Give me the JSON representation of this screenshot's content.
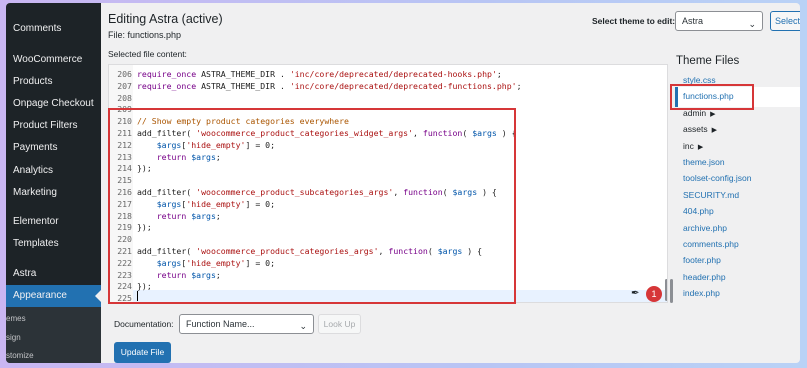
{
  "sidebar": {
    "items": [
      {
        "label": "Comments"
      },
      {
        "label": "WooCommerce"
      },
      {
        "label": "Products"
      },
      {
        "label": "Onpage Checkout"
      },
      {
        "label": "Product Filters"
      },
      {
        "label": "Payments"
      },
      {
        "label": "Analytics"
      },
      {
        "label": "Marketing"
      },
      {
        "label": "Elementor"
      },
      {
        "label": "Templates"
      },
      {
        "label": "Astra"
      },
      {
        "label": "Appearance"
      }
    ],
    "submenu": [
      {
        "label": "emes"
      },
      {
        "label": "sign"
      },
      {
        "label": "stomize"
      }
    ]
  },
  "header": {
    "title": "Editing Astra (active)",
    "file": "File: functions.php",
    "selected_label": "Selected file content:",
    "theme_label": "Select theme to edit:",
    "theme_value": "Astra",
    "theme_button": "Select"
  },
  "editor": {
    "lines": [
      {
        "n": "206",
        "code": "require_once ASTRA_THEME_DIR . 'inc/core/deprecated/deprecated-hooks.php';"
      },
      {
        "n": "207",
        "code": "require_once ASTRA_THEME_DIR . 'inc/core/deprecated/deprecated-functions.php';"
      },
      {
        "n": "208",
        "code": ""
      },
      {
        "n": "209",
        "code": ""
      },
      {
        "n": "210",
        "code": "// Show empty product categories everywhere"
      },
      {
        "n": "211",
        "code": "add_filter( 'woocommerce_product_categories_widget_args', function( $args ) {"
      },
      {
        "n": "212",
        "code": "    $args['hide_empty'] = 0;"
      },
      {
        "n": "213",
        "code": "    return $args;"
      },
      {
        "n": "214",
        "code": "});"
      },
      {
        "n": "215",
        "code": ""
      },
      {
        "n": "216",
        "code": "add_filter( 'woocommerce_product_subcategories_args', function( $args ) {"
      },
      {
        "n": "217",
        "code": "    $args['hide_empty'] = 0;"
      },
      {
        "n": "218",
        "code": "    return $args;"
      },
      {
        "n": "219",
        "code": "});"
      },
      {
        "n": "220",
        "code": ""
      },
      {
        "n": "221",
        "code": "add_filter( 'woocommerce_product_categories_args', function( $args ) {"
      },
      {
        "n": "222",
        "code": "    $args['hide_empty'] = 0;"
      },
      {
        "n": "223",
        "code": "    return $args;"
      },
      {
        "n": "224",
        "code": "});"
      },
      {
        "n": "225",
        "code": ""
      }
    ],
    "notification_count": "1"
  },
  "theme_files": {
    "title": "Theme Files",
    "items": [
      {
        "label": "style.css",
        "type": "file"
      },
      {
        "label": "functions.php",
        "type": "current"
      },
      {
        "label": "admin",
        "type": "dir"
      },
      {
        "label": "assets",
        "type": "dir"
      },
      {
        "label": "inc",
        "type": "dir"
      },
      {
        "label": "theme.json",
        "type": "file"
      },
      {
        "label": "toolset-config.json",
        "type": "file"
      },
      {
        "label": "SECURITY.md",
        "type": "file"
      },
      {
        "label": "404.php",
        "type": "file"
      },
      {
        "label": "archive.php",
        "type": "file"
      },
      {
        "label": "comments.php",
        "type": "file"
      },
      {
        "label": "footer.php",
        "type": "file"
      },
      {
        "label": "header.php",
        "type": "file"
      },
      {
        "label": "index.php",
        "type": "file"
      }
    ]
  },
  "documentation": {
    "label": "Documentation:",
    "select_value": "Function Name...",
    "lookup_button": "Look Up"
  },
  "update_button": "Update File",
  "colors": {
    "accent": "#2271b1",
    "highlight": "#d63638",
    "sidebar": "#1d2327"
  }
}
